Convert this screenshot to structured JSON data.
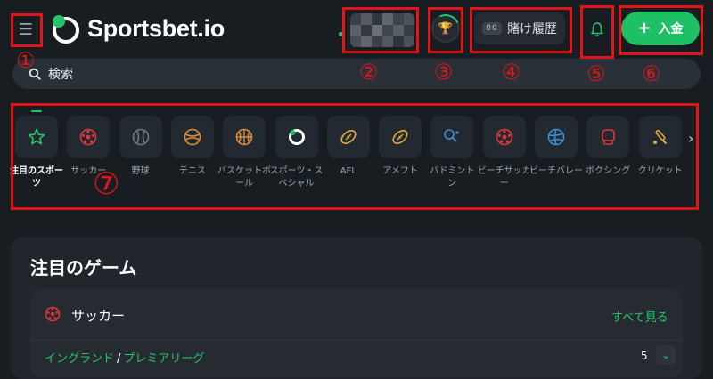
{
  "header": {
    "brand": "Sportsbet.io",
    "bet_history_label": "賭け履歴",
    "bet_history_icon_text": "00",
    "deposit_label": "入金",
    "deposit_icon": "plus-icon",
    "menu_icon": "hamburger-icon",
    "notification_icon": "bell-icon",
    "reward_icon": "trophy-icon"
  },
  "search": {
    "placeholder": "検索",
    "icon": "search-icon"
  },
  "sports": [
    {
      "label": "注目のスポーツ",
      "icon": "star-icon",
      "color": "#23c56a",
      "active": true
    },
    {
      "label": "サッカー",
      "icon": "soccer-ball-icon",
      "color": "#e0343b"
    },
    {
      "label": "野球",
      "icon": "baseball-icon",
      "color": "#6f7780"
    },
    {
      "label": "テニス",
      "icon": "tennis-ball-icon",
      "color": "#d98c3a"
    },
    {
      "label": "バスケットボール",
      "icon": "basketball-icon",
      "color": "#d98c3a"
    },
    {
      "label": "スポーツ・スペシャル",
      "icon": "special-ring-icon",
      "color": "#ffffff"
    },
    {
      "label": "AFL",
      "icon": "afl-ball-icon",
      "color": "#e3a93a"
    },
    {
      "label": "アメフト",
      "icon": "american-football-icon",
      "color": "#e3a93a"
    },
    {
      "label": "バドミントン",
      "icon": "badminton-icon",
      "color": "#3a8fd8"
    },
    {
      "label": "ビーチサッカー",
      "icon": "beach-soccer-icon",
      "color": "#e0343b"
    },
    {
      "label": "ビーチバレー",
      "icon": "volleyball-icon",
      "color": "#3a8fd8"
    },
    {
      "label": "ボクシング",
      "icon": "boxing-glove-icon",
      "color": "#e0343b"
    },
    {
      "label": "クリケット",
      "icon": "cricket-bat-icon",
      "color": "#e3a93a"
    }
  ],
  "featured": {
    "title": "注目のゲーム",
    "sport_label": "サッカー",
    "sport_icon": "soccer-ball-icon",
    "see_all_label": "すべて見る",
    "league_country": "イングランド",
    "league_separator": "/",
    "league_name": "プレミアリーグ",
    "match_count": "5"
  },
  "annotations": [
    "①",
    "②",
    "③",
    "④",
    "⑤",
    "⑥",
    "⑦"
  ],
  "colors": {
    "accent": "#23c56a",
    "background": "#181d22",
    "annotation": "#e1141a"
  }
}
